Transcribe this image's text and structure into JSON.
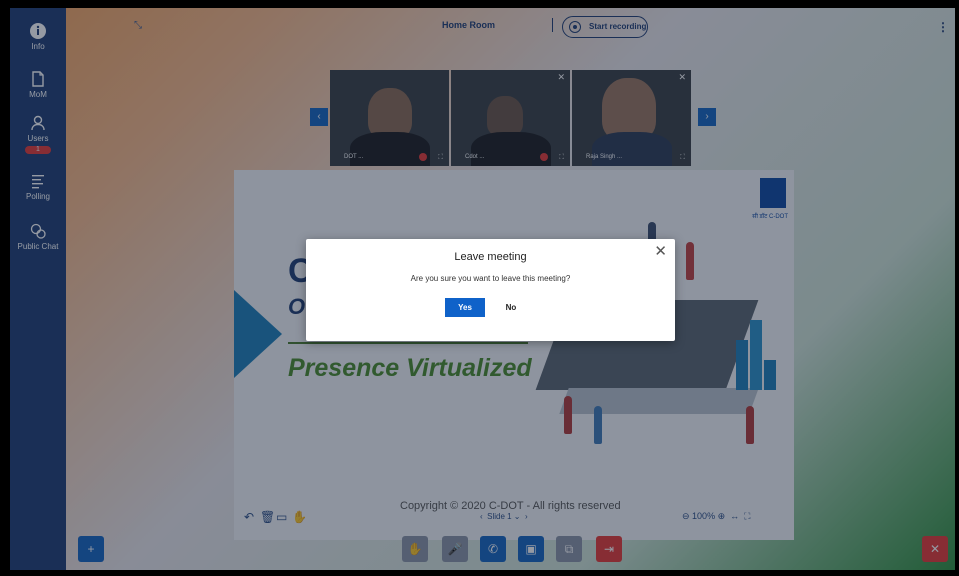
{
  "sidebar": {
    "items": [
      {
        "label": "Info",
        "icon": "info-icon"
      },
      {
        "label": "MoM",
        "icon": "document-icon"
      },
      {
        "label": "Users",
        "icon": "user-icon",
        "badge": "1"
      },
      {
        "label": "Polling",
        "icon": "list-icon"
      },
      {
        "label": "Public Chat",
        "icon": "chat-icon"
      }
    ]
  },
  "header": {
    "room_name": "Home Room",
    "record_label": "Start recording"
  },
  "videos": [
    {
      "name": "DOT ..."
    },
    {
      "name": "Cdot ..."
    },
    {
      "name": "Raja Singh ..."
    }
  ],
  "slide": {
    "letter_c": "C",
    "letter_o": "O",
    "tagline": "Presence Virtualized",
    "copyright": "Copyright © 2020 C-DOT - All rights reserved",
    "logo_text": "सी डॉट C-DOT"
  },
  "slide_tools": {
    "pager": "Slide 1",
    "zoom": "100%"
  },
  "dialog": {
    "title": "Leave meeting",
    "message": "Are you sure you want to leave this meeting?",
    "yes_label": "Yes",
    "no_label": "No"
  },
  "colors": {
    "sidebar": "#1f3d73",
    "primary": "#0f62c9",
    "danger": "#e53935"
  }
}
